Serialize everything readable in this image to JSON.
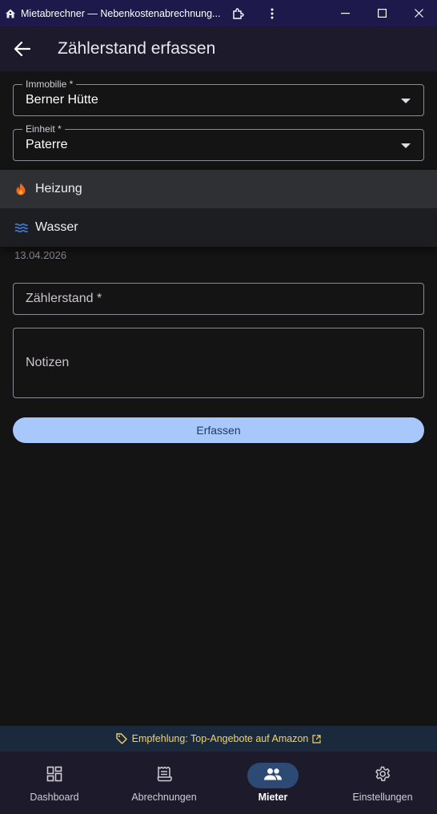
{
  "window": {
    "title": "Mietabrechner — Nebenkostenabrechnung...",
    "icons": [
      "app-home-icon",
      "extensions-icon",
      "more-vert-icon",
      "minimize-icon",
      "maximize-icon",
      "close-icon"
    ]
  },
  "appbar": {
    "title": "Zählerstand erfassen",
    "back_icon": "arrow-back-icon"
  },
  "form": {
    "immobilie": {
      "label": "Immobilie *",
      "value": "Berner Hütte"
    },
    "einheit": {
      "label": "Einheit *",
      "value": "Paterre"
    },
    "date_value_partial": "13.04.2026",
    "zaehlerstand": {
      "placeholder": "Zählerstand *"
    },
    "notizen": {
      "placeholder": "Notizen"
    },
    "submit_label": "Erfassen"
  },
  "dropdown": {
    "items": [
      {
        "label": "Heizung",
        "icon": "flame-icon",
        "color": "#f26a1b",
        "selected": true
      },
      {
        "label": "Wasser",
        "icon": "water-icon",
        "color": "#3e7fe0",
        "selected": false
      }
    ]
  },
  "banner": {
    "text": "Empfehlung: Top-Angebote auf Amazon",
    "color": "#f5d267"
  },
  "bottom_nav": {
    "items": [
      {
        "label": "Dashboard",
        "icon": "dashboard-icon",
        "active": false
      },
      {
        "label": "Abrechnungen",
        "icon": "receipt-icon",
        "active": false
      },
      {
        "label": "Mieter",
        "icon": "people-icon",
        "active": true
      },
      {
        "label": "Einstellungen",
        "icon": "settings-icon",
        "active": false
      }
    ]
  },
  "colors": {
    "accent": "#a8c7fa",
    "active_pill": "#2d4a74",
    "titlebar": "#1d1a4b"
  }
}
